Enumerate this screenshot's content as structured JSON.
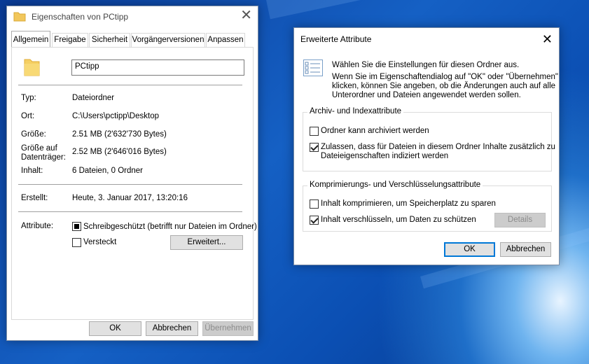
{
  "properties": {
    "title": "Eigenschaften von PCtipp",
    "tabs": [
      "Allgemein",
      "Freigabe",
      "Sicherheit",
      "Vorgängerversionen",
      "Anpassen"
    ],
    "folder_name": "PCtipp",
    "rows": {
      "typ": {
        "label": "Typ:",
        "value": "Dateiordner"
      },
      "ort": {
        "label": "Ort:",
        "value": "C:\\Users\\pctipp\\Desktop"
      },
      "groesse": {
        "label": "Größe:",
        "value": "2.51 MB (2'632'730 Bytes)"
      },
      "groesse_datentraeger": {
        "label1": "Größe auf",
        "label2": "Datenträger:",
        "value": "2.52 MB (2'646'016 Bytes)"
      },
      "inhalt": {
        "label": "Inhalt:",
        "value": "6 Dateien, 0 Ordner"
      },
      "erstellt": {
        "label": "Erstellt:",
        "value": "Heute, 3. Januar 2017, 13:20:16"
      }
    },
    "attribute_label": "Attribute:",
    "readonly_label": "Schreibgeschützt (betrifft nur Dateien im Ordner)",
    "hidden_label": "Versteckt",
    "advanced_button": "Erweitert...",
    "ok": "OK",
    "cancel": "Abbrechen",
    "apply": "Übernehmen"
  },
  "advanced": {
    "title": "Erweiterte Attribute",
    "intro1": "Wählen Sie die Einstellungen für diesen Ordner aus.",
    "intro2": "Wenn Sie im Eigenschaftendialog auf \"OK\" oder \"Übernehmen\"",
    "intro3": "klicken, können Sie angeben, ob die Änderungen auch auf alle",
    "intro4": "Unterordner und Dateien angewendet werden sollen.",
    "group1_title": "Archiv- und Indexattribute",
    "archive_label": "Ordner kann archiviert werden",
    "index_label1": "Zulassen, dass für Dateien in diesem Ordner Inhalte zusätzlich zu",
    "index_label2": "Dateieigenschaften indiziert werden",
    "group2_title": "Komprimierungs- und Verschlüsselungsattribute",
    "compress_label": "Inhalt komprimieren, um Speicherplatz zu sparen",
    "encrypt_label": "Inhalt verschlüsseln, um Daten zu schützen",
    "details_button": "Details",
    "ok": "OK",
    "cancel": "Abbrechen"
  }
}
